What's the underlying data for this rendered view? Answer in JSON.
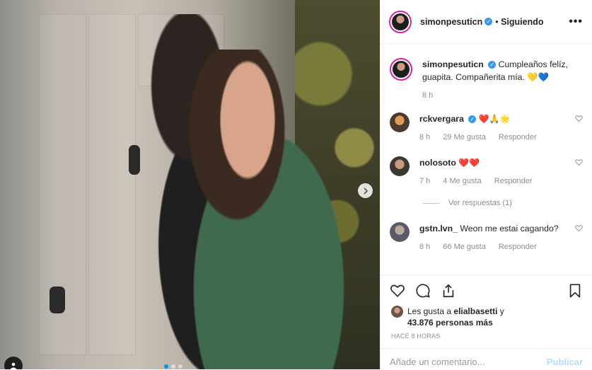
{
  "post": {
    "author": "simonpesuticn",
    "separator": "•",
    "follow_label": "Siguiendo",
    "more_label": "•••"
  },
  "caption": {
    "user": "simonpesuticn",
    "text": "Cumpleaños felíz, guapita. Compañerita mía. 💛💙",
    "time": "8 h"
  },
  "comments": [
    {
      "user": "rckvergara",
      "verified": true,
      "text": "❤️🙏🌟",
      "time": "8 h",
      "likes": "29 Me gusta",
      "reply": "Responder"
    },
    {
      "user": "nolosoto",
      "verified": false,
      "text": "❤️❤️",
      "time": "7 h",
      "likes": "4 Me gusta",
      "reply": "Responder"
    },
    {
      "user": "gstn.lvn_",
      "verified": false,
      "text": "Weon me estai cagando?",
      "time": "8 h",
      "likes": "66 Me gusta",
      "reply": "Responder"
    }
  ],
  "view_replies": "Ver respuestas (1)",
  "likes": {
    "prefix": "Les gusta a",
    "first_user": "elialbasetti",
    "joiner": "y",
    "count_text": "43.876 personas más"
  },
  "timestamp": "HACE 8 HORAS",
  "comment_box": {
    "placeholder": "Añade un comentario...",
    "publish_label": "Publicar"
  },
  "icons": {
    "like": "heart-icon",
    "comment": "comment-icon",
    "share": "share-icon",
    "save": "bookmark-icon",
    "next": "chevron-right-icon",
    "tag": "user-tag-icon"
  },
  "colors": {
    "verified": "#3897f0",
    "publish": "#b2dffc",
    "carousel_active": "#0095f6"
  }
}
